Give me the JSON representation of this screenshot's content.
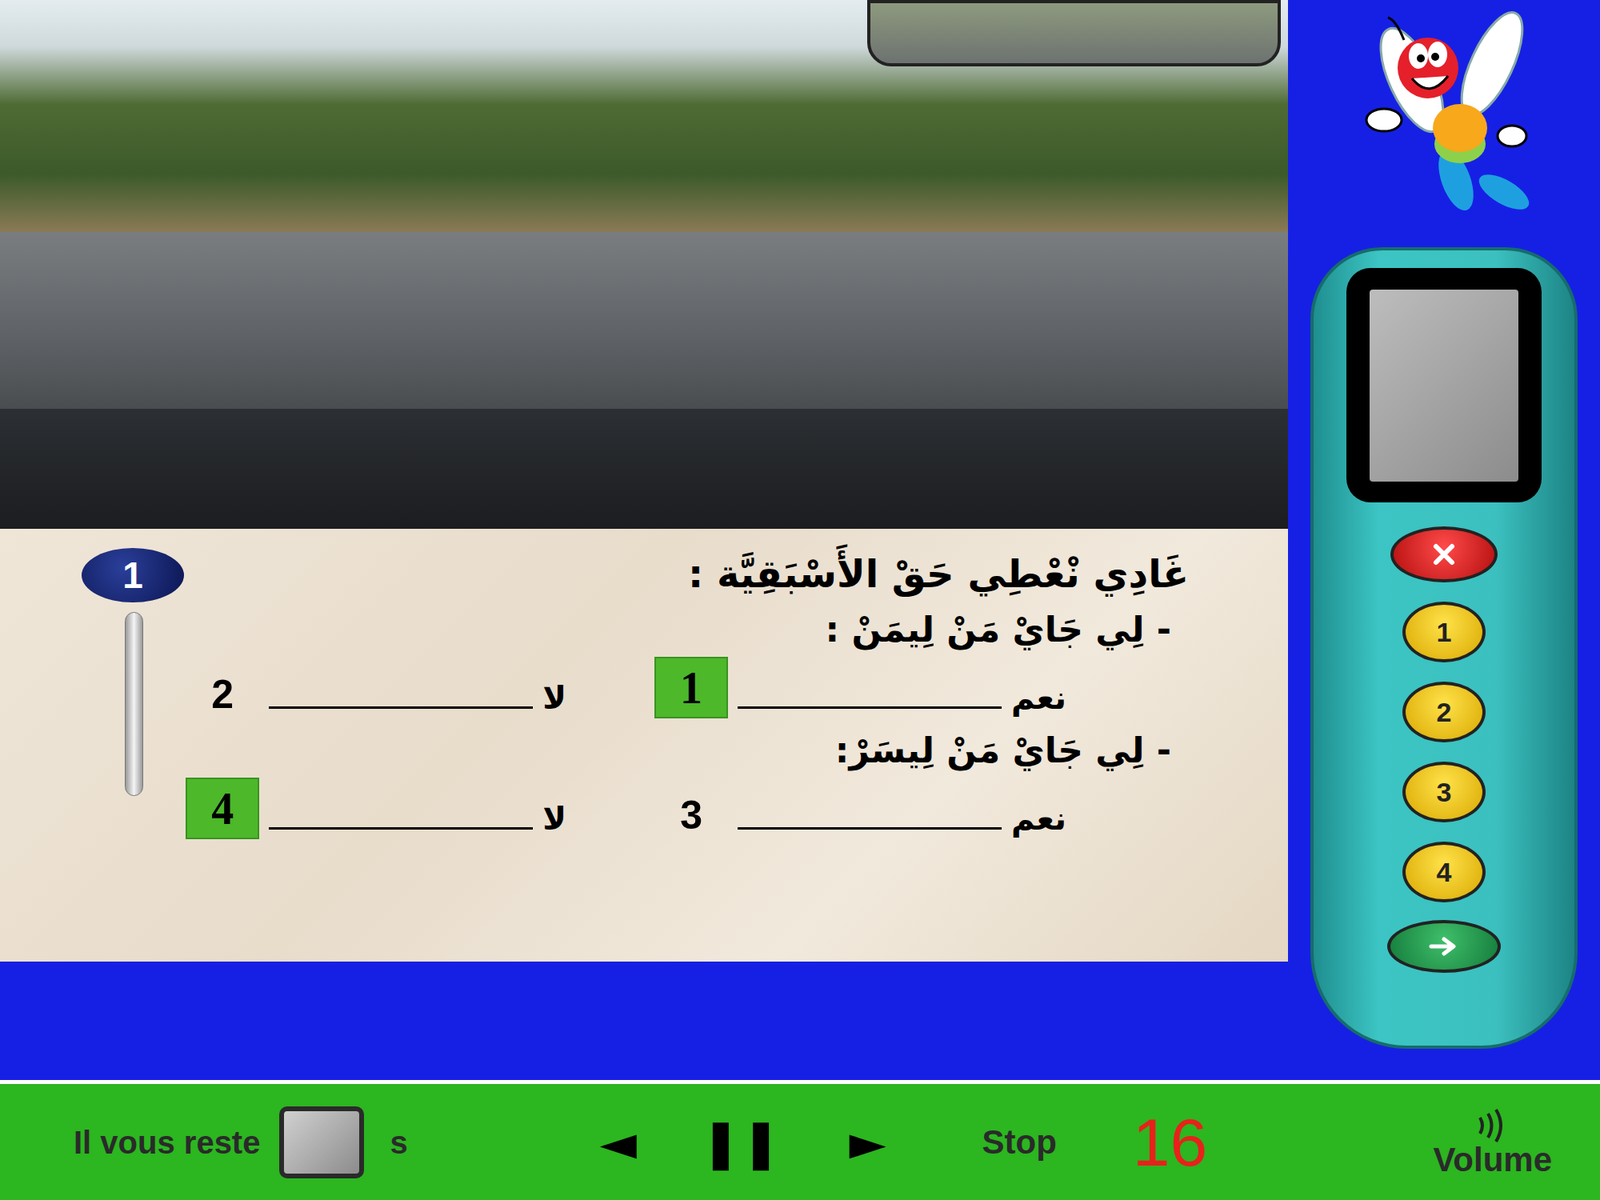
{
  "question": {
    "number": "1",
    "prompt": "غَادِي نْعْطِي حَقْ الأَسْبَقِيَّة :",
    "groups": [
      {
        "label": "- لِي جَايْ مَنْ لِيمَنْ :",
        "options": [
          {
            "label": "نعم",
            "number": "1",
            "selected": true
          },
          {
            "label": "لا",
            "number": "2",
            "selected": false
          }
        ]
      },
      {
        "label": "- لِي جَايْ مَنْ لِيسَرْ:",
        "options": [
          {
            "label": "نعم",
            "number": "3",
            "selected": false
          },
          {
            "label": "لا",
            "number": "4",
            "selected": true
          }
        ]
      }
    ]
  },
  "remote": {
    "buttons": [
      {
        "label": "1"
      },
      {
        "label": "2"
      },
      {
        "label": "3"
      },
      {
        "label": "4"
      }
    ]
  },
  "footer": {
    "remaining_label": "Il vous reste",
    "unit": "s",
    "controls": [
      "◄",
      "❚❚",
      "►"
    ],
    "stop": "Stop",
    "counter": "16",
    "volume": "Volume"
  }
}
